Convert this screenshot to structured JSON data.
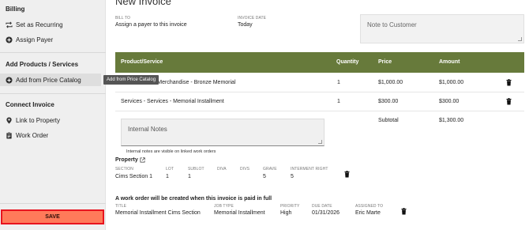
{
  "sidebar": {
    "billing_heading": "Billing",
    "set_recurring": "Set as Recurring",
    "assign_payer": "Assign Payer",
    "add_products_heading": "Add Products / Services",
    "add_from_catalog": "Add from Price Catalog",
    "connect_heading": "Connect Invoice",
    "link_property": "Link to Property",
    "work_order": "Work Order",
    "save_label": "SAVE",
    "save_color": "#ff7a5a"
  },
  "tooltip": "Add from Price Catalog",
  "page": {
    "title": "New Invoice"
  },
  "bill_to": {
    "label": "BILL TO",
    "value": "Assign a payer to this invoice"
  },
  "invoice_date": {
    "label": "INVOICE DATE",
    "value": "Today"
  },
  "note_to_customer": {
    "placeholder": "Note to Customer"
  },
  "table": {
    "header_color": "#677a3b",
    "headers": {
      "product": "Product/Service",
      "quantity": "Quantity",
      "price": "Price",
      "amount": "Amount"
    },
    "rows": [
      {
        "product": "Merchandise - Merchandise - Bronze Memorial",
        "quantity": "1",
        "price": "$1,000.00",
        "amount": "$1,000.00"
      },
      {
        "product": "Services - Services - Memorial Installment",
        "quantity": "1",
        "price": "$300.00",
        "amount": "$300.00"
      }
    ],
    "subtotal_label": "Subtotal",
    "subtotal_value": "$1,300.00"
  },
  "internal_notes": {
    "placeholder": "Internal Notes",
    "helper": "Internal notes are visible on linked work orders"
  },
  "property": {
    "title": "Property",
    "labels": {
      "section": "SECTION",
      "lot": "LOT",
      "sublot": "SUBLOT",
      "diva": "DIVA",
      "divs": "DIVS",
      "grave": "GRAVE",
      "interment_right": "INTERMENT RIGHT"
    },
    "values": {
      "section": "Cims Section 1",
      "lot": "1",
      "sublot": "1",
      "grave": "5",
      "interment_right": "5"
    }
  },
  "work_order": {
    "title": "A work order will be created when this invoice is paid in full",
    "labels": {
      "title": "TITLE",
      "job_type": "JOB TYPE",
      "priority": "PRIORITY",
      "due_date": "DUE DATE",
      "assigned_to": "ASSIGNED TO"
    },
    "values": {
      "title": "Memorial Installment Cims Section",
      "job_type": "Memorial Installment",
      "priority": "High",
      "due_date": "01/31/2026",
      "assigned_to": "Eric Marte"
    }
  }
}
